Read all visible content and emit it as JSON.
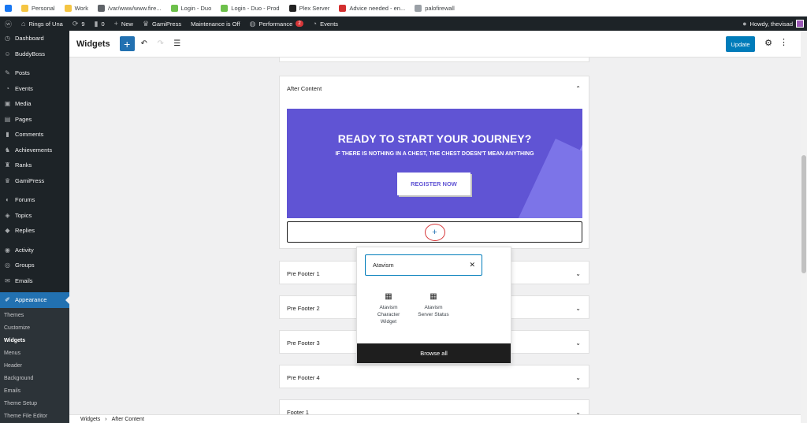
{
  "bookmarks": [
    {
      "label": "",
      "icon": "facebook-icon",
      "color": "#1877f2"
    },
    {
      "label": "Personal",
      "icon": "folder-icon",
      "color": "#f5c542"
    },
    {
      "label": "Work",
      "icon": "folder-icon",
      "color": "#f5c542"
    },
    {
      "label": "/var/www/www.fire...",
      "icon": "globe-icon",
      "color": "#5f6368"
    },
    {
      "label": "Login - Duo",
      "icon": "duo-icon",
      "color": "#6dc04b"
    },
    {
      "label": "Login - Duo - Prod",
      "icon": "duo-icon",
      "color": "#6dc04b"
    },
    {
      "label": "Plex Server",
      "icon": "plex-icon",
      "color": "#222222"
    },
    {
      "label": "Advice needed - en...",
      "icon": "l-icon",
      "color": "#d32f2f"
    },
    {
      "label": "palofirewall",
      "icon": "doc-icon",
      "color": "#9aa0a6"
    }
  ],
  "admin_bar": {
    "site_name": "Rings of Una",
    "updates": "9",
    "comments": "0",
    "new": "New",
    "gamipress": "GamiPress",
    "maintenance": "Maintenance is Off",
    "performance": "Performance",
    "performance_badge": "2",
    "events": "Events",
    "howdy": "Howdy, thevisad"
  },
  "sidebar": {
    "items": [
      {
        "label": "Dashboard",
        "icon": "dashboard-icon"
      },
      {
        "label": "BuddyBoss",
        "icon": "buddyboss-icon"
      },
      {
        "label": "Posts",
        "icon": "pin-icon"
      },
      {
        "label": "Events",
        "icon": "events-icon"
      },
      {
        "label": "Media",
        "icon": "media-icon"
      },
      {
        "label": "Pages",
        "icon": "pages-icon"
      },
      {
        "label": "Comments",
        "icon": "comments-icon"
      },
      {
        "label": "Achievements",
        "icon": "achievements-icon"
      },
      {
        "label": "Ranks",
        "icon": "ranks-icon"
      },
      {
        "label": "GamiPress",
        "icon": "gamipress-icon"
      },
      {
        "label": "Forums",
        "icon": "forums-icon"
      },
      {
        "label": "Topics",
        "icon": "topics-icon"
      },
      {
        "label": "Replies",
        "icon": "replies-icon"
      },
      {
        "label": "Activity",
        "icon": "activity-icon"
      },
      {
        "label": "Groups",
        "icon": "groups-icon"
      },
      {
        "label": "Emails",
        "icon": "emails-icon"
      },
      {
        "label": "Appearance",
        "icon": "appearance-icon"
      }
    ],
    "submenu": [
      "Themes",
      "Customize",
      "Widgets",
      "Menus",
      "Header",
      "Background",
      "Emails",
      "Theme Setup",
      "Theme File Editor"
    ]
  },
  "header": {
    "title": "Widgets",
    "update": "Update"
  },
  "after_content": {
    "title": "After Content",
    "banner_title": "READY TO START YOUR JOURNEY?",
    "banner_subtitle": "IF THERE IS NOTHING IN A CHEST, THE CHEST DOESN'T MEAN ANYTHING",
    "banner_button": "REGISTER NOW",
    "appender": "+"
  },
  "areas": [
    "Pre Footer 1",
    "Pre Footer 2",
    "Pre Footer 3",
    "Pre Footer 4",
    "Footer 1"
  ],
  "inserter": {
    "search_value": "Atavism",
    "blocks": [
      "Atavism Character Widget",
      "Atavism Server Status"
    ],
    "browse_all": "Browse all"
  },
  "breadcrumb": [
    "Widgets",
    "After Content"
  ],
  "colors": {
    "accent": "#2271b1",
    "admin_dark": "#1d2327",
    "banner": "#6054d4"
  }
}
